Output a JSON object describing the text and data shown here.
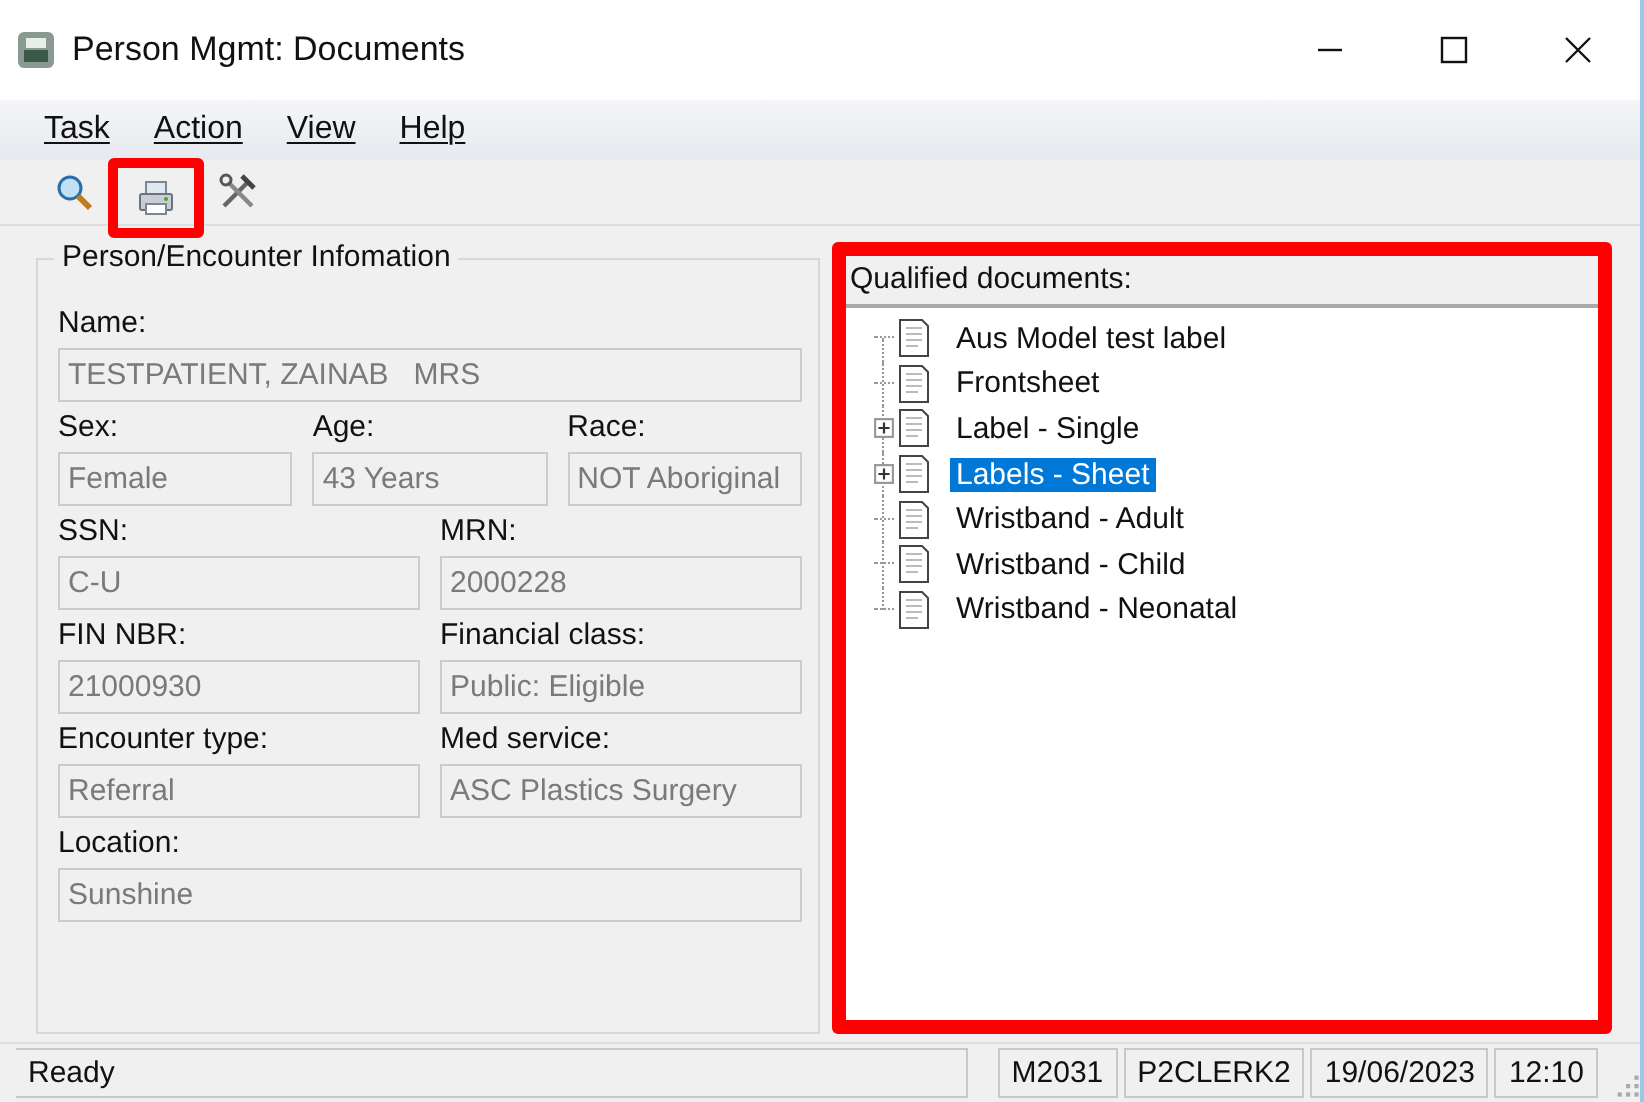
{
  "window": {
    "title": "Person Mgmt: Documents"
  },
  "menu": [
    "Task",
    "Action",
    "View",
    "Help"
  ],
  "toolbar": [
    {
      "kind": "search",
      "highlighted": false
    },
    {
      "kind": "print",
      "highlighted": true
    },
    {
      "kind": "tools",
      "highlighted": false
    }
  ],
  "person_info": {
    "title": "Person/Encounter Infomation",
    "rows": [
      [
        {
          "label": "Name:",
          "value": "TESTPATIENT, ZAINAB   MRS"
        }
      ],
      [
        {
          "label": "Sex:",
          "value": "Female"
        },
        {
          "label": "Age:",
          "value": "43 Years"
        },
        {
          "label": "Race:",
          "value": "NOT Aboriginal"
        }
      ],
      [
        {
          "label": "SSN:",
          "value": "C-U"
        },
        {
          "label": "MRN:",
          "value": "2000228"
        }
      ],
      [
        {
          "label": "FIN NBR:",
          "value": "21000930"
        },
        {
          "label": "Financial class:",
          "value": "Public: Eligible"
        }
      ],
      [
        {
          "label": "Encounter type:",
          "value": "Referral"
        },
        {
          "label": "Med service:",
          "value": "ASC Plastics Surgery"
        }
      ],
      [
        {
          "label": "Location:",
          "value": "Sunshine"
        }
      ]
    ]
  },
  "documents": {
    "title": "Qualified documents:",
    "highlighted": true,
    "items": [
      {
        "label": "Aus Model test label",
        "expandable": false,
        "selected": false
      },
      {
        "label": "Frontsheet",
        "expandable": false,
        "selected": false
      },
      {
        "label": "Label - Single",
        "expandable": true,
        "selected": false
      },
      {
        "label": "Labels - Sheet",
        "expandable": true,
        "selected": true
      },
      {
        "label": "Wristband - Adult",
        "expandable": false,
        "selected": false
      },
      {
        "label": "Wristband - Child",
        "expandable": false,
        "selected": false
      },
      {
        "label": "Wristband - Neonatal",
        "expandable": false,
        "selected": false
      }
    ]
  },
  "status_bar": [
    "Ready",
    "M2031",
    "P2CLERK2",
    "19/06/2023",
    "12:10"
  ]
}
